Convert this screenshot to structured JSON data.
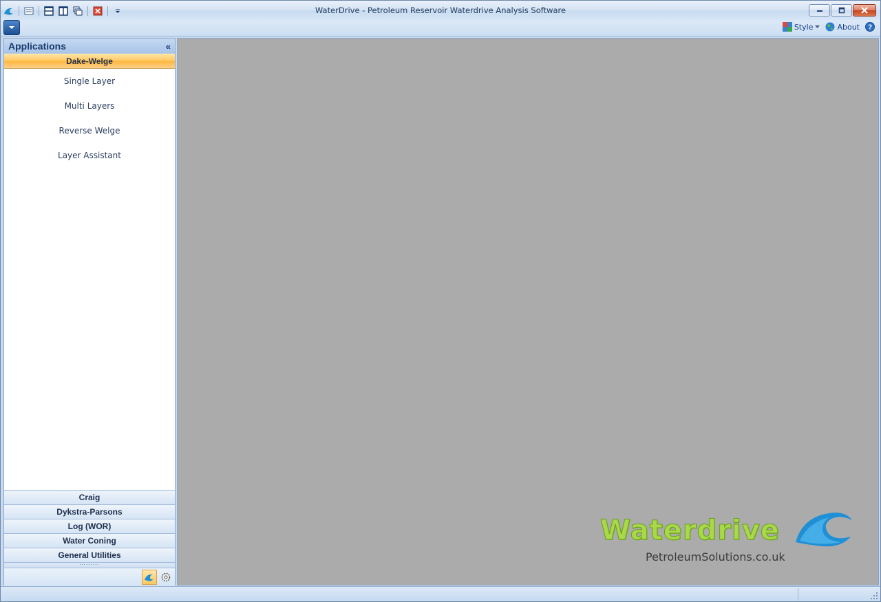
{
  "window": {
    "title": "WaterDrive - Petroleum Reservoir Waterdrive Analysis Software"
  },
  "quick_access_toolbar": {
    "items": [
      {
        "name": "app-logo-icon"
      },
      {
        "name": "window-list-icon"
      },
      {
        "name": "tile-horizontal-icon"
      },
      {
        "name": "tile-vertical-icon"
      },
      {
        "name": "cascade-icon"
      },
      {
        "name": "close-all-icon"
      },
      {
        "name": "customize-dropdown-icon"
      }
    ]
  },
  "ribbon": {
    "style_label": "Style",
    "about_label": "About"
  },
  "sidebar": {
    "header": "Applications",
    "collapse_glyph": "«",
    "active_group": "Dake-Welge",
    "items": [
      {
        "label": "Single Layer"
      },
      {
        "label": "Multi Layers"
      },
      {
        "label": "Reverse Welge"
      },
      {
        "label": "Layer Assistant"
      }
    ],
    "groups": [
      {
        "label": "Craig"
      },
      {
        "label": "Dykstra-Parsons"
      },
      {
        "label": "Log (WOR)"
      },
      {
        "label": "Water Coning"
      },
      {
        "label": "General Utilities"
      }
    ],
    "grip": "⋯⋯⋯"
  },
  "main": {
    "logo_text": "Waterdrive",
    "logo_site": "PetroleumSolutions.co.uk"
  },
  "colors": {
    "accent": "#ffc862",
    "workspace": "#ababab",
    "logo_green": "#a9d84a",
    "logo_blue": "#1f8fd6"
  }
}
